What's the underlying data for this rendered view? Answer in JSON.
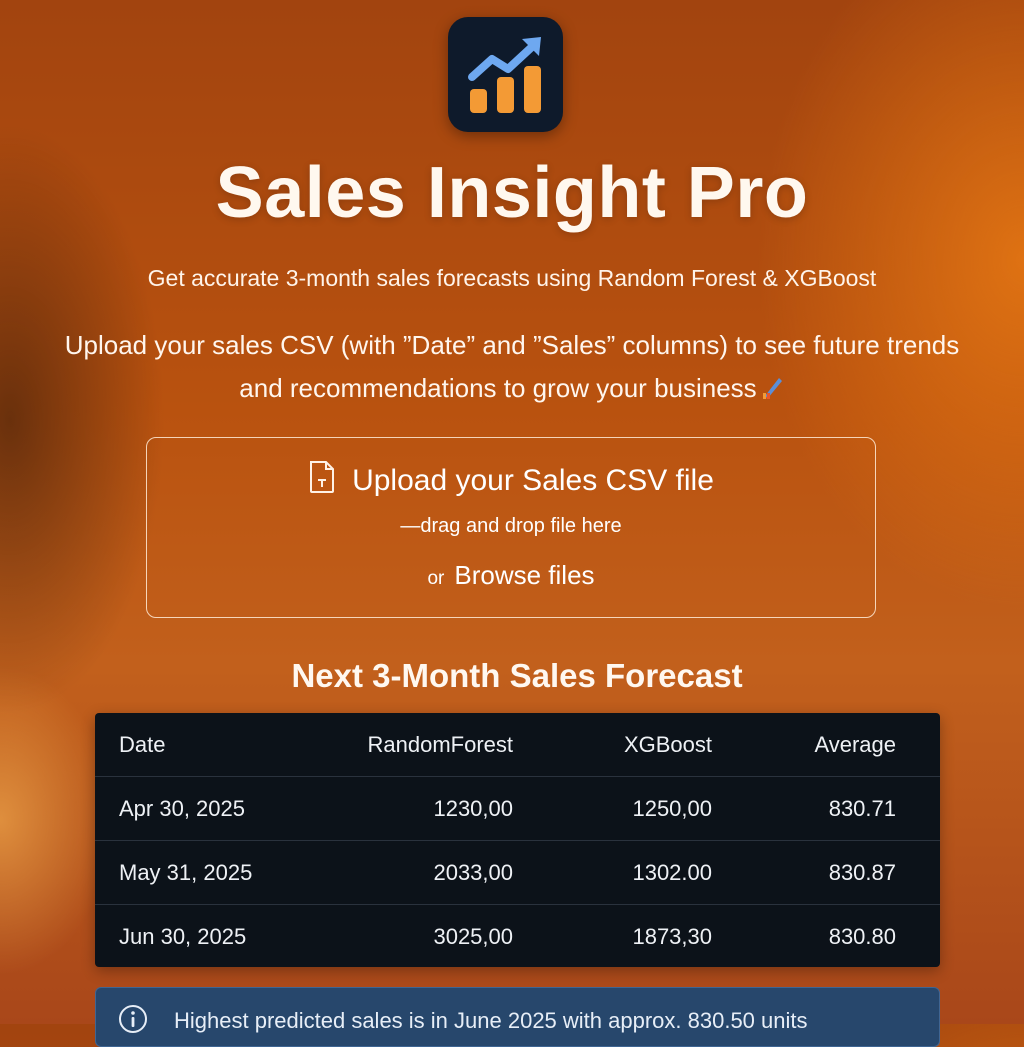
{
  "app": {
    "icon": "growth-chart-icon",
    "title": "Sales Insight Pro",
    "subtitle": "Get accurate 3-month sales forecasts using Random Forest & XGBoost"
  },
  "intro": {
    "line1": "Upload your sales CSV (with ”Date” and ”Sales” columns) to see future trends",
    "line2": "and recommendations to grow your business",
    "trailing_icon": "rocket-icon"
  },
  "uploader": {
    "icon": "file-icon",
    "title": "Upload your Sales CSV file",
    "hint": "—drag and drop file here",
    "or_label": "or",
    "browse_label": "Browse files"
  },
  "forecast": {
    "title": "Next 3-Month Sales Forecast",
    "columns": [
      "Date",
      "RandomForest",
      "XGBoost",
      "Average"
    ],
    "rows": [
      [
        "Apr 30, 2025",
        "1230,00",
        "1250,00",
        "830.71"
      ],
      [
        "May 31, 2025",
        "2033,00",
        "1302.00",
        "830.87"
      ],
      [
        "Jun 30, 2025",
        "3025,00",
        "1873,30",
        "830.80"
      ]
    ]
  },
  "insight": {
    "icon": "info-icon",
    "text": "Highest predicted sales is in June 2025 with approx. 830.50 units"
  },
  "colors": {
    "background": "#b9520f",
    "accent_orange": "#f39a35",
    "chart_line": "#6ea8f0",
    "table_bg": "#0c1219",
    "info_bg": "#27476c"
  }
}
